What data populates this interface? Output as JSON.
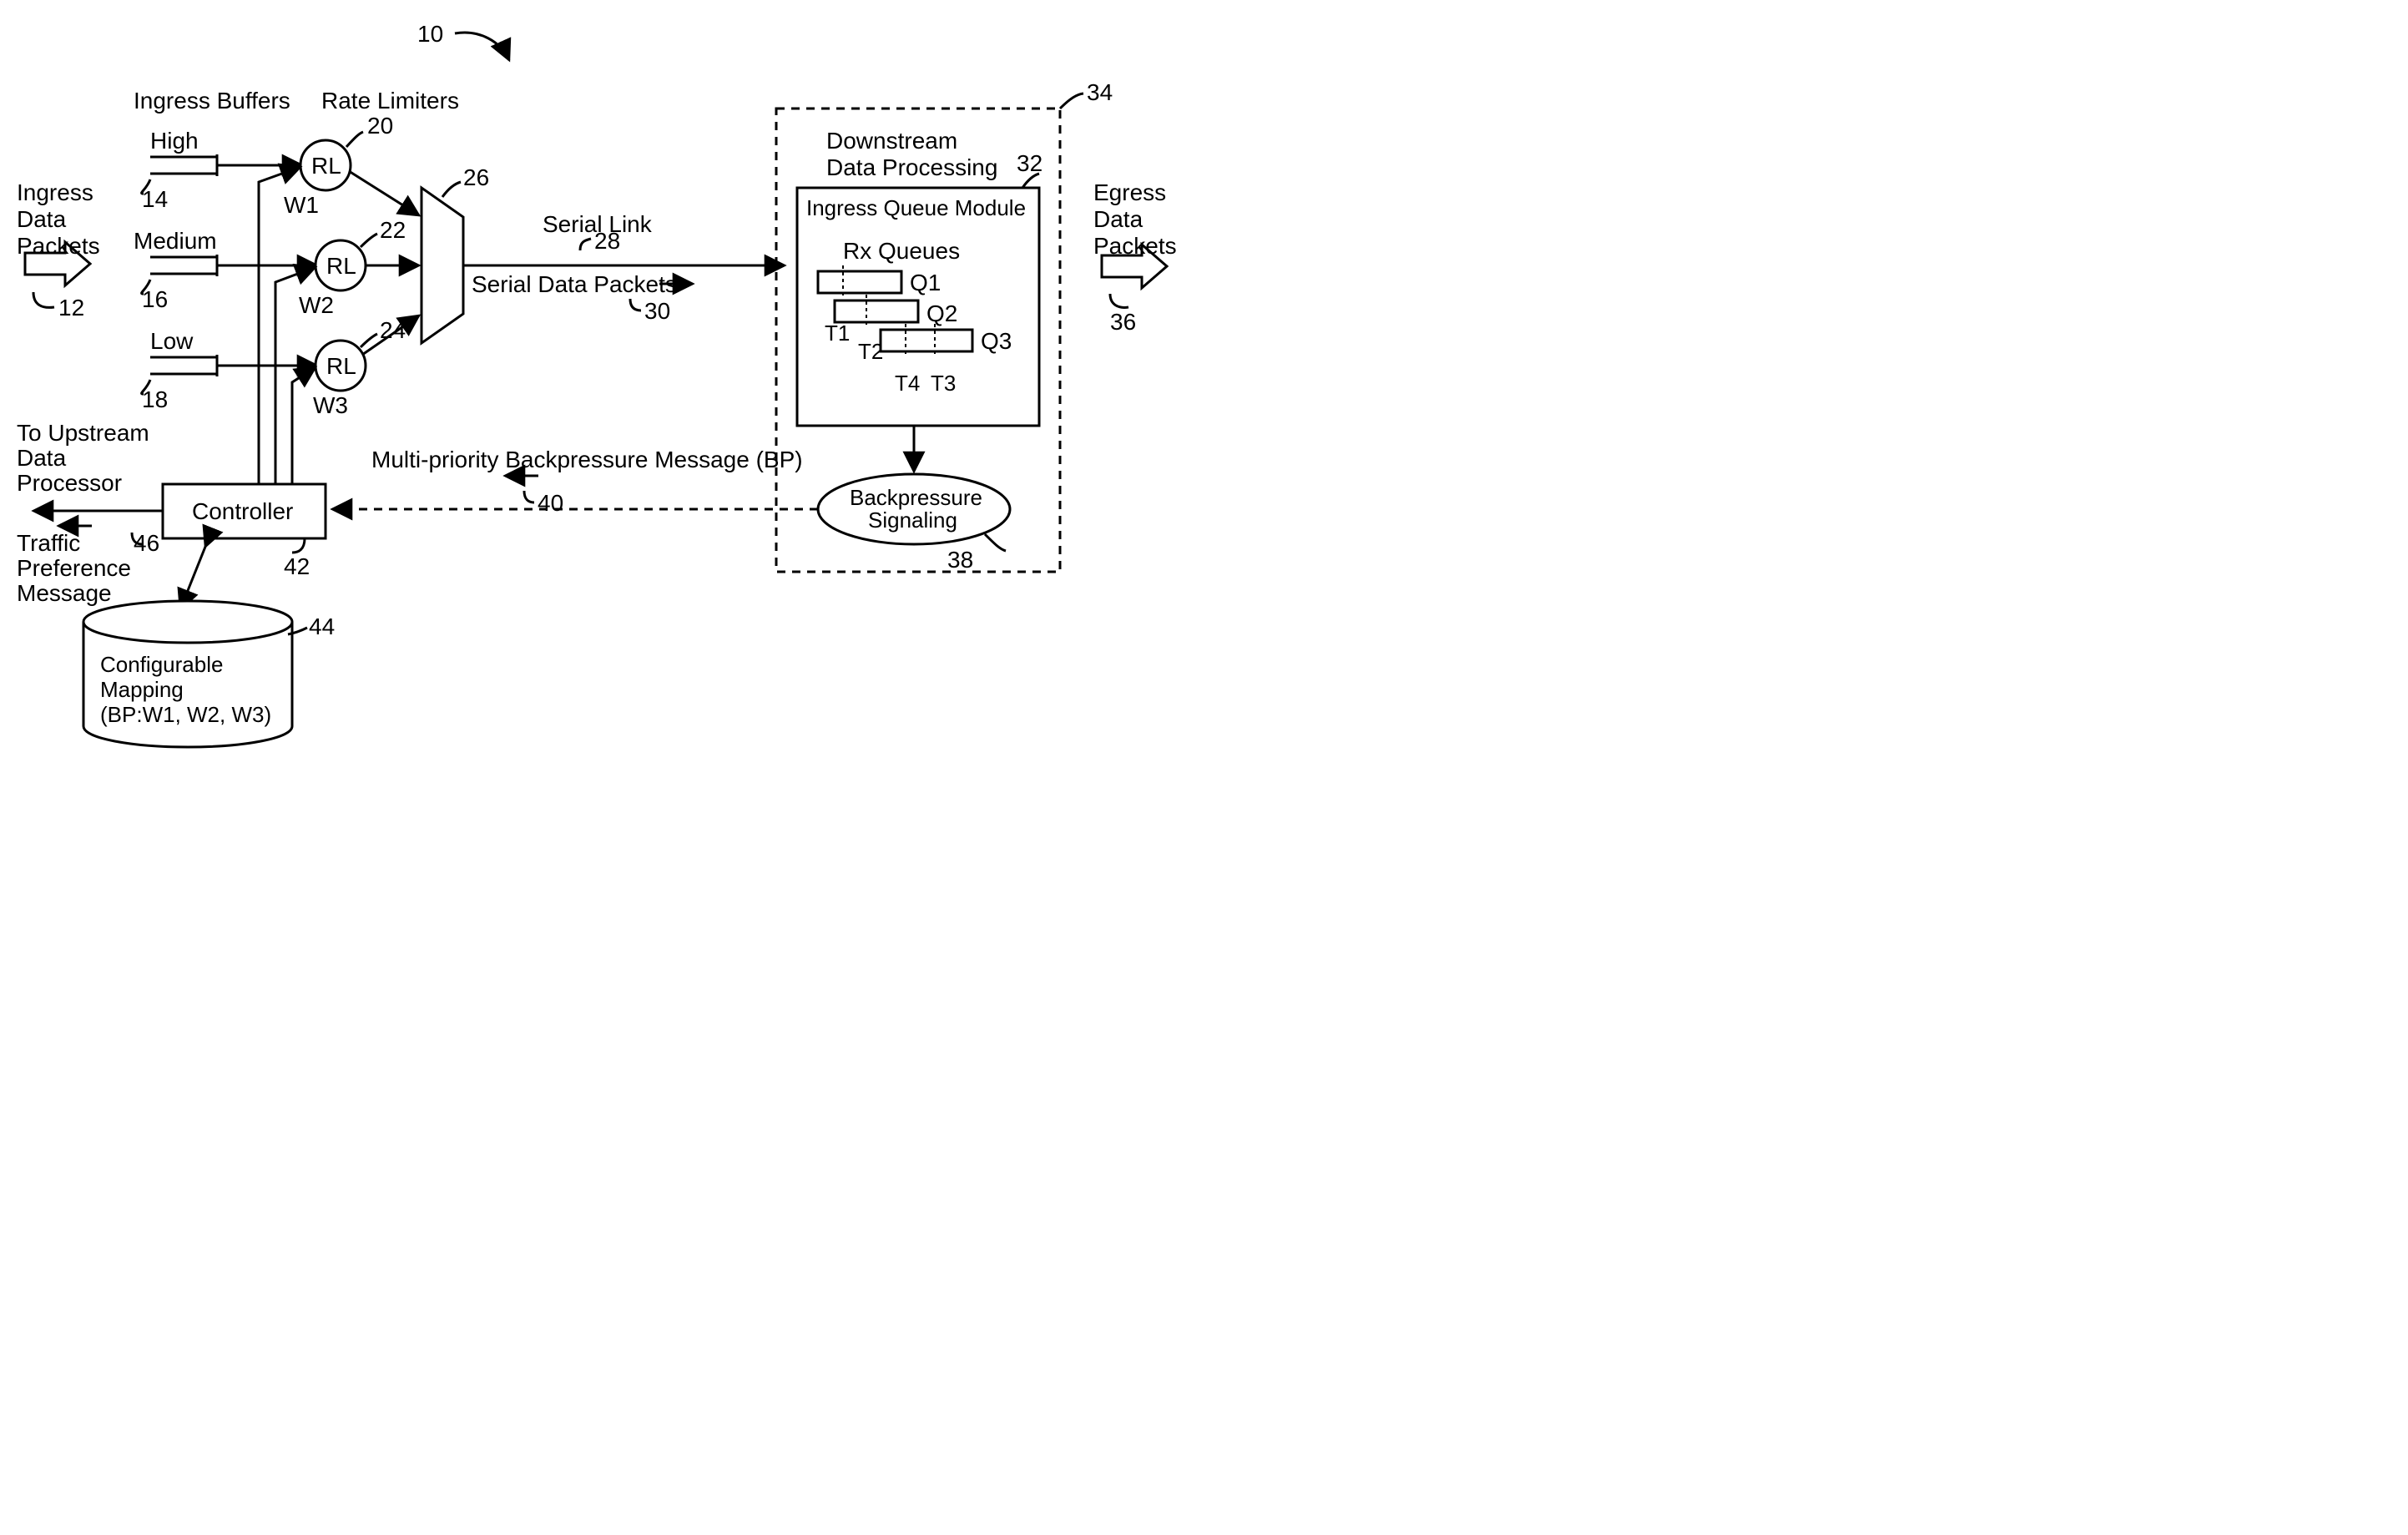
{
  "fig_ref": "10",
  "labels": {
    "ingress_buffers": "Ingress Buffers",
    "rate_limiters": "Rate Limiters",
    "high": "High",
    "medium": "Medium",
    "low": "Low",
    "rl": "RL",
    "w1": "W1",
    "w2": "W2",
    "w3": "W3",
    "ingress_data_packets_l1": "Ingress",
    "ingress_data_packets_l2": "Data",
    "ingress_data_packets_l3": "Packets",
    "egress_data_packets_l1": "Egress",
    "egress_data_packets_l2": "Data",
    "egress_data_packets_l3": "Packets",
    "serial_link": "Serial Link",
    "serial_data_packets": "Serial Data Packets",
    "downstream_l1": "Downstream",
    "downstream_l2": "Data Processing",
    "ingress_queue_module": "Ingress Queue Module",
    "rx_queues": "Rx Queues",
    "q1": "Q1",
    "q2": "Q2",
    "q3": "Q3",
    "t1": "T1",
    "t2": "T2",
    "t3": "T3",
    "t4": "T4",
    "bp_l1": "Backpressure",
    "bp_l2": "Signaling",
    "multi_bp": "Multi-priority Backpressure Message (BP)",
    "controller": "Controller",
    "mapping_l1": "Configurable",
    "mapping_l2": "Mapping",
    "mapping_l3": "(BP:W1, W2, W3)",
    "upstream_l1": "To Upstream",
    "upstream_l2": "Data",
    "upstream_l3": "Processor",
    "traffic_pref_l1": "Traffic",
    "traffic_pref_l2": "Preference",
    "traffic_pref_l3": "Message"
  },
  "refs": {
    "r10": "10",
    "r12": "12",
    "r14": "14",
    "r16": "16",
    "r18": "18",
    "r20": "20",
    "r22": "22",
    "r24": "24",
    "r26": "26",
    "r28": "28",
    "r30": "30",
    "r32": "32",
    "r34": "34",
    "r36": "36",
    "r38": "38",
    "r40": "40",
    "r42": "42",
    "r44": "44",
    "r46": "46"
  }
}
